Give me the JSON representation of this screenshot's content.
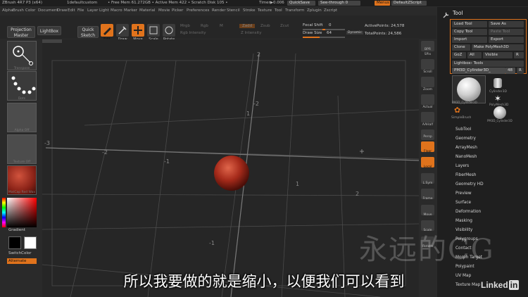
{
  "titlebar": {
    "app": "ZBrush 4R7 P3 (x64)",
    "project": "1defaultcustom",
    "free_mem": "• Free Mem 61.272GB • Active Mem 422 • Scratch Disk 105 •",
    "timer": "Timer▶0.006",
    "quicksave": "QuickSave",
    "see_through": "See-through  0",
    "menus": "Menus",
    "script": "DefaultZScript"
  },
  "menubar": [
    "Alpha",
    "Brush",
    "Color",
    "Document",
    "Draw",
    "Edit",
    "File",
    "Layer",
    "Light",
    "Macro",
    "Marker",
    "Material",
    "Movie",
    "Picker",
    "Preferences",
    "Render",
    "Stencil",
    "Stroke",
    "Texture",
    "Tool",
    "Transform",
    "Zplugin",
    "Zscript"
  ],
  "toolbar": {
    "projection_master": "Projection Master",
    "lightbox": "LightBox",
    "quick_sketch": "Quick Sketch",
    "edit": "Edit",
    "draw": "Draw",
    "move": "Move",
    "scale": "Scale",
    "rotate": "Rotate",
    "mrgb": "Mrgb",
    "rgb": "Rgb",
    "m": "M",
    "zadd": "Zadd",
    "zsub": "Zsub",
    "zcut": "Zcut",
    "rgb_intensity": "Rgb Intensity",
    "z_intensity": "Z Intensity",
    "focal_shift_label": "Focal Shift",
    "focal_shift_value": "0",
    "draw_size_label": "Draw Size",
    "draw_size_value": "64",
    "dynamic": "Dynamic",
    "active_points": "ActivePoints: 24,578",
    "total_points": "TotalPoints: 24,586"
  },
  "leftshelf": {
    "captions": [
      "Transpose",
      "Dots",
      "Alpha Off",
      "Texture Off",
      "MatCap Red Wax"
    ],
    "gradient": "Gradient",
    "switch_color": "SwitchColor",
    "alternate": "Alternate"
  },
  "rightshelf": [
    "BPR",
    "SPix",
    "Scroll",
    "Zoom",
    "Actual",
    "AAHalf",
    "Persp",
    "Floor",
    "Local",
    "L.Sym",
    "Frame",
    "Move",
    "Scale",
    "Rotate"
  ],
  "tool": {
    "title": "Tool",
    "load_tool": "Load Tool",
    "save_as": "Save As",
    "copy_tool": "Copy Tool",
    "paste_tool": "Paste Tool",
    "import": "Import",
    "export": "Export",
    "clone": "Clone",
    "make_polymesh": "Make PolyMesh3D",
    "goz": "GoZ",
    "all": "All",
    "visible": "Visible",
    "r": "R",
    "lightbox_tools": "Lightbox› Tools",
    "current": "PM3D_Cylinder3D_",
    "current_num": "48",
    "thumbs": [
      "PM3D_Cylinder3D",
      "Cylinder3D",
      "PolyMesh3D",
      "SimpleBrush",
      "PM3D_Cylinder3D"
    ],
    "items": [
      "SubTool",
      "Geometry",
      "ArrayMesh",
      "NanoMesh",
      "Layers",
      "FiberMesh",
      "Geometry HD",
      "Preview",
      "Surface",
      "Deformation",
      "Masking",
      "Visibility",
      "Polygroups",
      "Contact",
      "Morph Target",
      "Polypaint",
      "UV Map",
      "Texture Map"
    ]
  },
  "viewport": {
    "grid_labels": [
      "-3",
      "-2",
      "-1",
      "1",
      "2",
      "-1",
      "-2",
      "2",
      "1"
    ]
  },
  "subtitle": "所以我要做的就是缩小，以便我们可以看到",
  "watermark": "永远的CG",
  "linkedin": {
    "text": "Linked",
    "in": "in"
  },
  "colors": {
    "accent": "#e0731c",
    "sphere": "#b0301f"
  }
}
